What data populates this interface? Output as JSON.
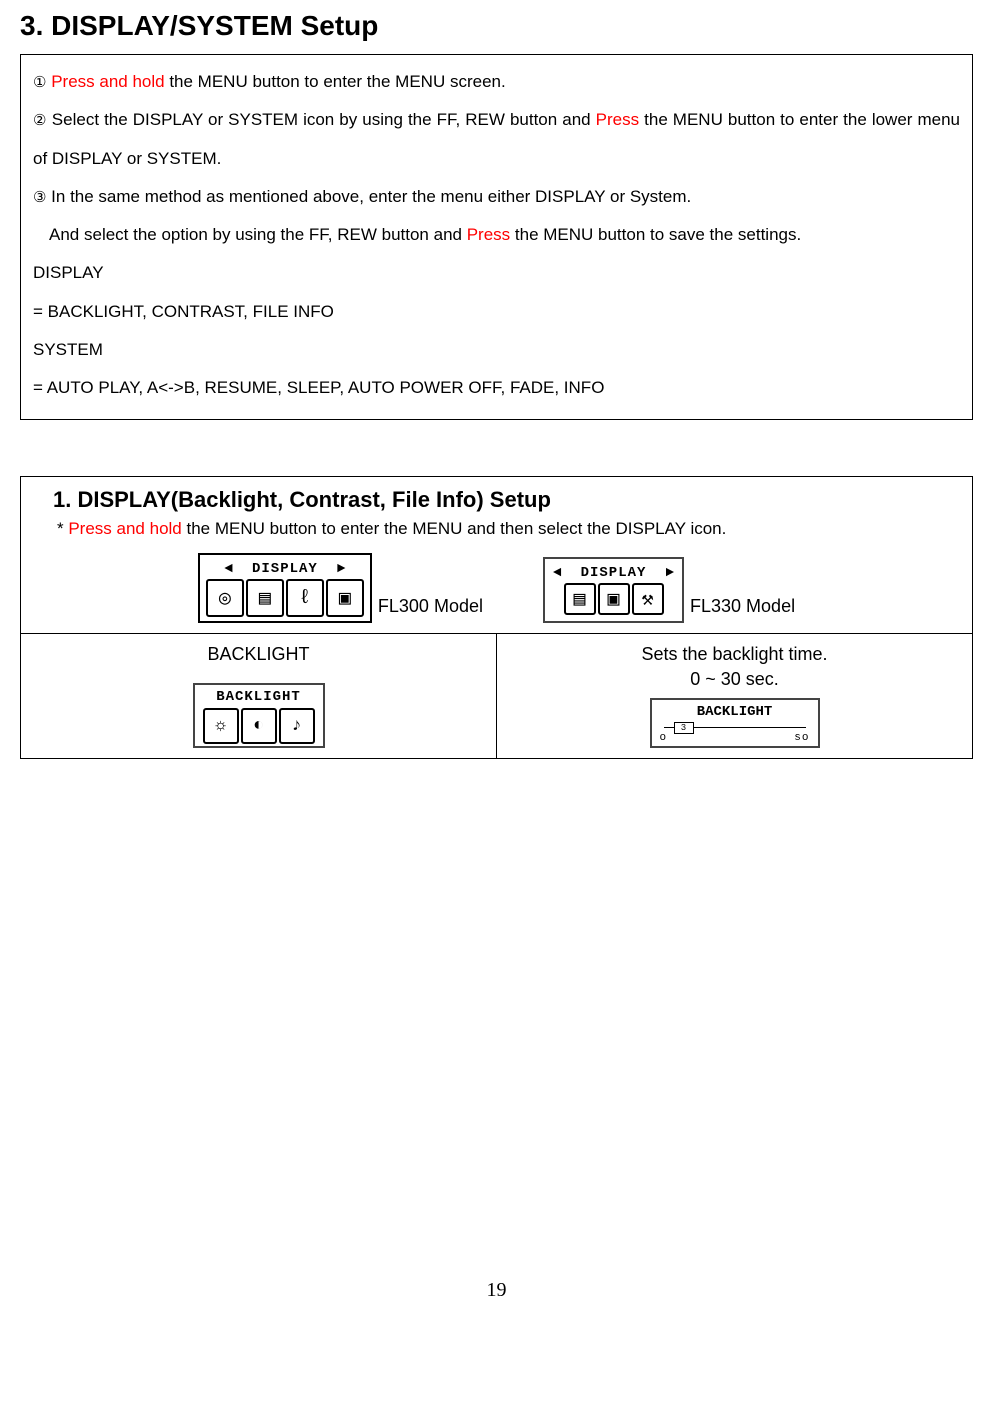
{
  "title": "3. DISPLAY/SYSTEM Setup",
  "step1_marker": "①",
  "step1_red": "Press and hold",
  "step1_text_a": " the MENU button to enter the ",
  "step1_text_b": "MENU screen.",
  "step2_marker": "②",
  "step2_a": " Select the DISPLAY or SYSTEM icon by using the FF, REW button and ",
  "step2_red": "Press",
  "step2_b": " the MENU button to enter the lower menu of DISPLAY or SYSTEM.",
  "step3_marker": "③",
  "step3": " In the same method as mentioned above, enter the menu either DISPLAY or System.",
  "step3_and": "And ",
  "step3_and_rest": "select the option by using the FF, REW button and ",
  "step3_and_red": "Press",
  "step3_and_tail": " the MENU button to save the settings.",
  "display_label": "DISPLAY",
  "display_vals": "= BACKLIGHT, CONTRAST, FILE INFO",
  "system_label": "SYSTEM",
  "system_vals": "= AUTO PLAY, A<->B, RESUME, SLEEP, AUTO POWER OFF, FADE, INFO",
  "sub_title": "1. DISPLAY(Backlight, Contrast, File Info) Setup",
  "sub_prefix": "* ",
  "sub_red": "Press and hold",
  "sub_tail": " the MENU button to enter the MENU and then select the DISPLAY icon.",
  "screen_display": "DISPLAY",
  "model_fl300": "FL300 Model",
  "model_fl330": "FL330 Model",
  "backlight_label": "BACKLIGHT",
  "backlight_desc": "Sets the backlight time.",
  "backlight_range": "0 ~ 30 sec.",
  "slider_title": "BACKLIGHT",
  "slider_value": "3",
  "slider_min": "o",
  "slider_max": "so",
  "page_number": "19"
}
